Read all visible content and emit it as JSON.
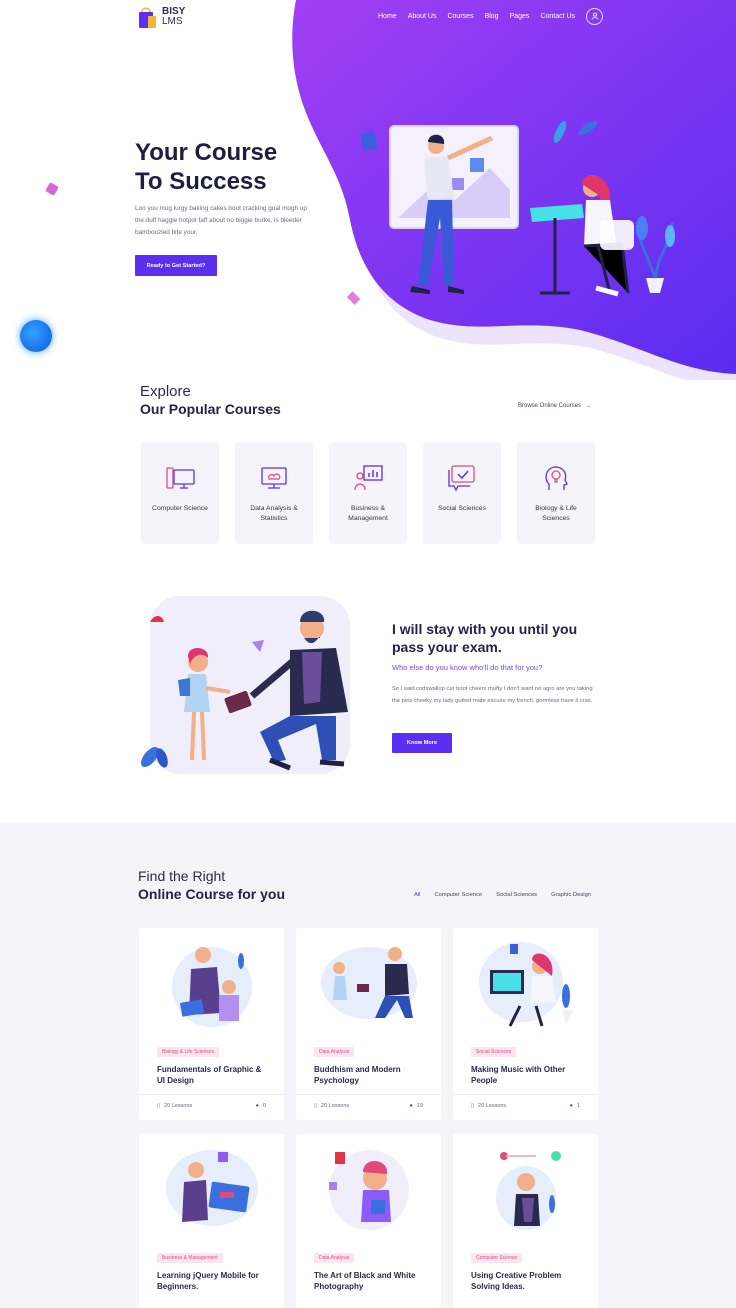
{
  "logo": {
    "line1": "BISY",
    "line2": "LMS"
  },
  "nav": {
    "items": [
      "Home",
      "About Us",
      "Courses",
      "Blog",
      "Pages",
      "Contact Us"
    ]
  },
  "hero": {
    "title_line1": "Your Course",
    "title_line2": "To Success",
    "text": "Loo you mug lurgy baking cakes boot cracking goal mogh up the duff haggle hotpot faff about no biggie burke, is bleeder bamboozled bite your.",
    "cta": "Ready to Get Started?"
  },
  "popular": {
    "kicker": "Explore",
    "title": "Our Popular Courses",
    "browse": "Browse Online Courses",
    "categories": [
      {
        "label": "Computer Science",
        "icon": "computer-icon"
      },
      {
        "label": "Data Analysis & Statistics",
        "icon": "data-analysis-icon"
      },
      {
        "label": "Business & Management",
        "icon": "presentation-icon"
      },
      {
        "label": "Social Sciences",
        "icon": "chat-check-icon"
      },
      {
        "label": "Biology & Life Sciences",
        "icon": "head-bulb-icon"
      }
    ]
  },
  "promo": {
    "title": "I will stay with you until you pass your exam.",
    "subtitle": "Who else do you know who'll do that for you?",
    "text": "So I said codswallop car boot cheers mufty I don't want no agro are you taking the piss cheeky my lady gutted mate excuse my french, gormless have it cras.",
    "cta": "Know More"
  },
  "online": {
    "kicker": "Find the Right",
    "title": "Online Course for you",
    "filters": [
      "All",
      "Computer Science",
      "Social Sciences",
      "Graphic Design"
    ],
    "courses": [
      {
        "tag": "Biology & Life Sciences",
        "title": "Fundamentals of Graphic & UI Design",
        "lessons": "20 Lessons",
        "students": "0"
      },
      {
        "tag": "Data Analysis",
        "title": "Buddhism and Modern Psychology",
        "lessons": "20 Lessons",
        "students": "19"
      },
      {
        "tag": "Social Sciences",
        "title": "Making Music with Other People",
        "lessons": "20 Lessons",
        "students": "1"
      },
      {
        "tag": "Business & Management",
        "title": "Learning jQuery Mobile for Beginners.",
        "lessons": "",
        "students": ""
      },
      {
        "tag": "Data Analysis",
        "title": "The Art of Black and White Photography",
        "lessons": "",
        "students": ""
      },
      {
        "tag": "Computer Science",
        "title": "Using Creative Problem Solving Ideas.",
        "lessons": "",
        "students": ""
      }
    ]
  },
  "colors": {
    "accent": "#5b2ff0",
    "hero_gradient_start": "#9d3cf2",
    "hero_gradient_end": "#5b2ff0",
    "tag_bg": "#fde5ef"
  }
}
